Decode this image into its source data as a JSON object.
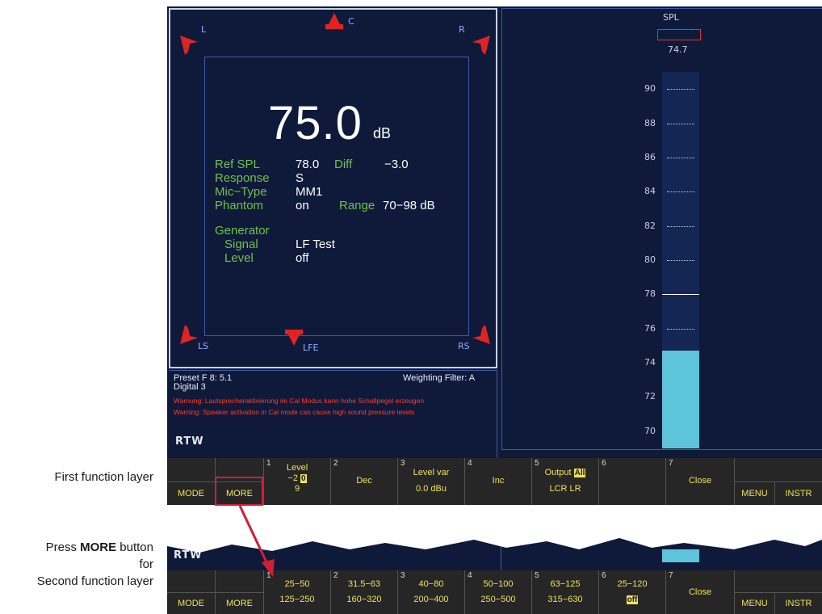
{
  "captions": {
    "first_layer": "First function layer",
    "press_prefix": "Press ",
    "press_bold": "MORE",
    "press_suffix": " button",
    "for": "for",
    "second_layer": "Second function layer"
  },
  "speakers": {
    "L": "L",
    "C": "C",
    "R": "R",
    "LS": "LS",
    "LFE": "LFE",
    "RS": "RS",
    "color": "#e02424"
  },
  "readout": {
    "value": "75.0",
    "unit": "dB",
    "ref_spl_label": "Ref SPL",
    "ref_spl_value": "78.0",
    "diff_label": "Diff",
    "diff_value": "−3.0",
    "response_label": "Response",
    "response_value": "S",
    "mic_type_label": "Mic−Type",
    "mic_type_value": "MM1",
    "phantom_label": "Phantom",
    "phantom_value": "on",
    "range_label": "Range",
    "range_value": "70−98 dB",
    "generator_label": "Generator",
    "signal_label": "Signal",
    "signal_value": "LF Test",
    "level_label": "Level",
    "level_value": "off"
  },
  "info": {
    "preset": "Preset F 8: 5.1",
    "source": "Digital 3",
    "weighting": "Weighting Filter: A",
    "warning_de": "Warnung: Lautsprecheraktivierung im Cal Modus kann hohe Schallpegel erzeugen",
    "warning_en": "Warning: Speaker activation in Cal mode can cause high sound pressure levels",
    "logo": "RTW"
  },
  "meter": {
    "label": "SPL",
    "value_text": "74.7",
    "ticks": [
      "90",
      "88",
      "86",
      "84",
      "82",
      "80",
      "78",
      "76",
      "74",
      "72",
      "70"
    ],
    "scale_min": 69,
    "scale_max": 91,
    "level": 74.7,
    "reference": 78.0,
    "bar_color": "#5ec4dc"
  },
  "layer1": {
    "mode": "MODE",
    "more": "MORE",
    "keys": [
      {
        "num": "1",
        "l1": "Level",
        "l2": "−2",
        "l2_hl": "0",
        "l3": "9"
      },
      {
        "num": "2",
        "l1": "",
        "l2": "Dec",
        "l3": ""
      },
      {
        "num": "3",
        "l1": "Level var",
        "l2": "",
        "l3": "0.0 dBu"
      },
      {
        "num": "4",
        "l1": "",
        "l2": "Inc",
        "l3": ""
      },
      {
        "num": "5",
        "l1": "Output",
        "l1_hl": "All",
        "l2": "",
        "l3": "LCR LR"
      },
      {
        "num": "6",
        "l1": "",
        "l2": "",
        "l3": ""
      },
      {
        "num": "7",
        "l1": "",
        "l2": "Close",
        "l3": ""
      }
    ],
    "menu": "MENU",
    "instr": "INSTR"
  },
  "layer2": {
    "mode": "MODE",
    "more": "MORE",
    "keys": [
      {
        "num": "1",
        "l1": "25−50",
        "l3": "125−250"
      },
      {
        "num": "2",
        "l1": "31.5−63",
        "l3": "160−320"
      },
      {
        "num": "3",
        "l1": "40−80",
        "l3": "200−400"
      },
      {
        "num": "4",
        "l1": "50−100",
        "l3": "250−500"
      },
      {
        "num": "5",
        "l1": "63−125",
        "l3": "315−630"
      },
      {
        "num": "6",
        "l1": "25−120",
        "l3_hl": "off"
      },
      {
        "num": "7",
        "l2": "Close"
      }
    ],
    "menu": "MENU",
    "instr": "INSTR"
  },
  "colors": {
    "screen_bg": "#0f1a3a",
    "label_green": "#6fc24a",
    "key_yellow": "#f1e25a",
    "warning_red": "#ff3b2f",
    "arrow_red": "#d11e37"
  }
}
